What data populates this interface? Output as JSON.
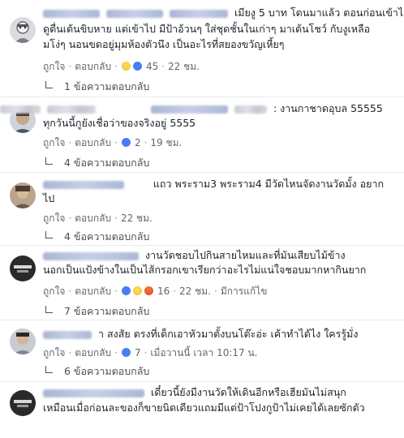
{
  "comments": [
    {
      "line1": "เมียงู 5 บาท โดนมาแล้ว ตอนก่อนเข้าไป",
      "line2": "ดูตื่นเต้นขิบหาย แต่เข้าไป มีป้าอ้วนๆ ใส่ชุดชั้นในเก่าๆ มาเต้นโชว์ กับงูเหลือ",
      "line3": "มโง่ๆ นอนขดอยู่มุมห้องตัวนึง เป็นอะไรที่สยองขวัญเหี้ยๆ",
      "like": "ถูกใจ",
      "reply": "ตอบกลับ",
      "reactions": [
        "haha",
        "like"
      ],
      "reaction_count": "45",
      "time": "22 ชม.",
      "replies": "1 ข้อความตอบกลับ"
    },
    {
      "line1": ": งานกาชาดอุบล 55555",
      "line2": "ทุกวันนี้กูยังเชื่อว่าของจริงอยู่ 5555",
      "like": "ถูกใจ",
      "reply": "ตอบกลับ",
      "reactions": [
        "like"
      ],
      "reaction_count": "2",
      "time": "19 ชม.",
      "replies": "4 ข้อความตอบกลับ"
    },
    {
      "line1": "แถว พระราม3 พระราม4 มีวัดไหนจัดงานวัดมั้ง อยาก",
      "line2": "ไป",
      "like": "ถูกใจ",
      "reply": "ตอบกลับ",
      "time": "22 ชม.",
      "replies": "4 ข้อความตอบกลับ"
    },
    {
      "line1": "งานวัดชอบไปกินสายไหมและที่มันเสียบไม้ข้าง",
      "line2": "นอกเป็นแป้งข้างในเป็นไส้กรอกเขาเรียกว่าอะไรไม่แน่ใจชอบมากหากินยาก",
      "like": "ถูกใจ",
      "reply": "ตอบกลับ",
      "reactions": [
        "like",
        "haha",
        "angry"
      ],
      "reaction_count": "16",
      "time": "22 ชม.",
      "edited": "มีการแก้ไข",
      "replies": "7 ข้อความตอบกลับ"
    },
    {
      "line1": "า สงสัย ตรงที่เด็กเอาหัวมาตั้งบนโต๊ะอ่ะ เค้าทำได้ไง ใครรู้มั่ง",
      "like": "ถูกใจ",
      "reply": "ตอบกลับ",
      "reactions": [
        "like"
      ],
      "reaction_count": "7",
      "time": "เมื่อวานนี้ เวลา 10:17 น.",
      "replies": "6 ข้อความตอบกลับ"
    },
    {
      "line1": "เดี๋ยวนี้ยังมีงานวัดให้เดินอีกหรือเฮียมันไม่สนุก",
      "line2": "เหมือนเมื่อก่อนละของก็ขายนิดเดียวแถมมีแต่ป้าโปงกูป้าไม่เคยได้เลยซักตัว"
    }
  ]
}
